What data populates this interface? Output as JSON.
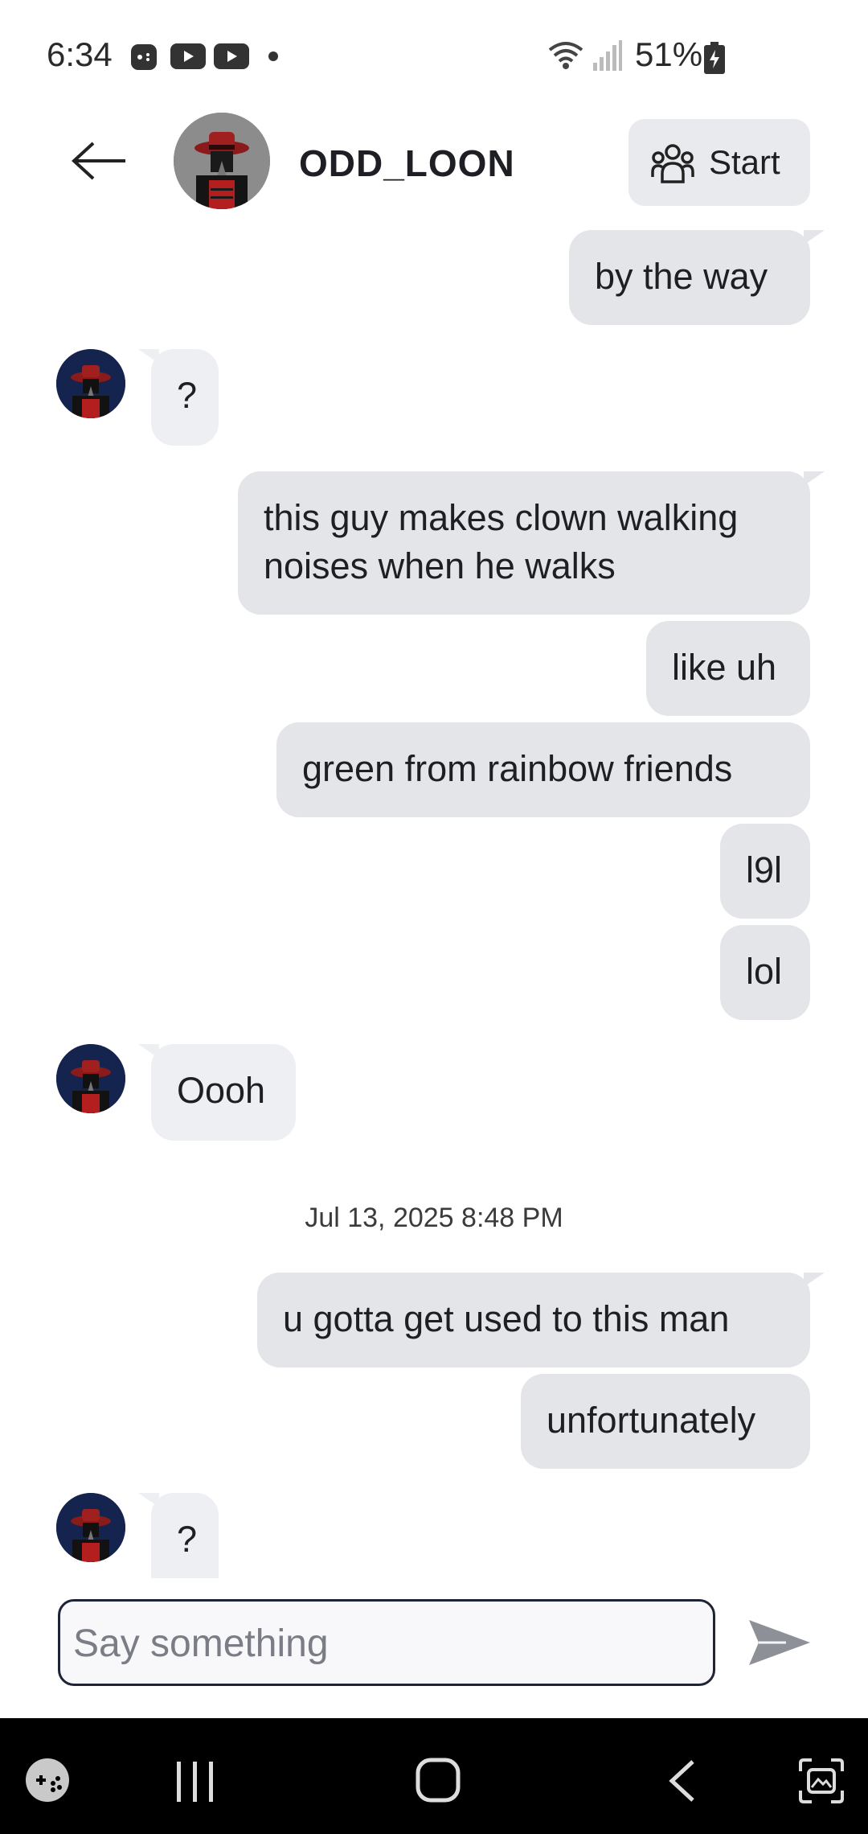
{
  "status_bar": {
    "time": "6:34",
    "battery": "51%",
    "icons": [
      "game-controller-icon",
      "youtube-icon",
      "youtube-icon",
      "dot-icon",
      "wifi-icon",
      "signal-icon",
      "battery-charging-icon"
    ]
  },
  "header": {
    "username": "ODD_LOON",
    "start_label": "Start",
    "icons": [
      "back-arrow-icon",
      "group-people-icon"
    ]
  },
  "messages": [
    {
      "side": "out",
      "text": "by the way"
    },
    {
      "side": "in",
      "text": "?"
    },
    {
      "side": "out",
      "text": "this guy makes clown walking noises when he walks"
    },
    {
      "side": "out",
      "text": "like uh"
    },
    {
      "side": "out",
      "text": "green from rainbow friends"
    },
    {
      "side": "out",
      "text": "l9l"
    },
    {
      "side": "out",
      "text": "lol"
    },
    {
      "side": "in",
      "text": "Oooh"
    },
    {
      "side": "out",
      "text": "u gotta get used to this man"
    },
    {
      "side": "out",
      "text": "unfortunately"
    },
    {
      "side": "in",
      "text": "?"
    }
  ],
  "date_separator": "Jul 13, 2025 8:48 PM",
  "composer": {
    "placeholder": "Say something",
    "value": ""
  },
  "colors": {
    "outgoing_bubble": "#e4e5e9",
    "incoming_bubble": "#eeeff3",
    "composer_border": "#1e2436",
    "send_icon": "#8e9098"
  },
  "nav_bar": {
    "icons": [
      "game-launcher-icon",
      "recents-icon",
      "home-icon",
      "nav-back-icon",
      "screen-capture-icon"
    ]
  }
}
